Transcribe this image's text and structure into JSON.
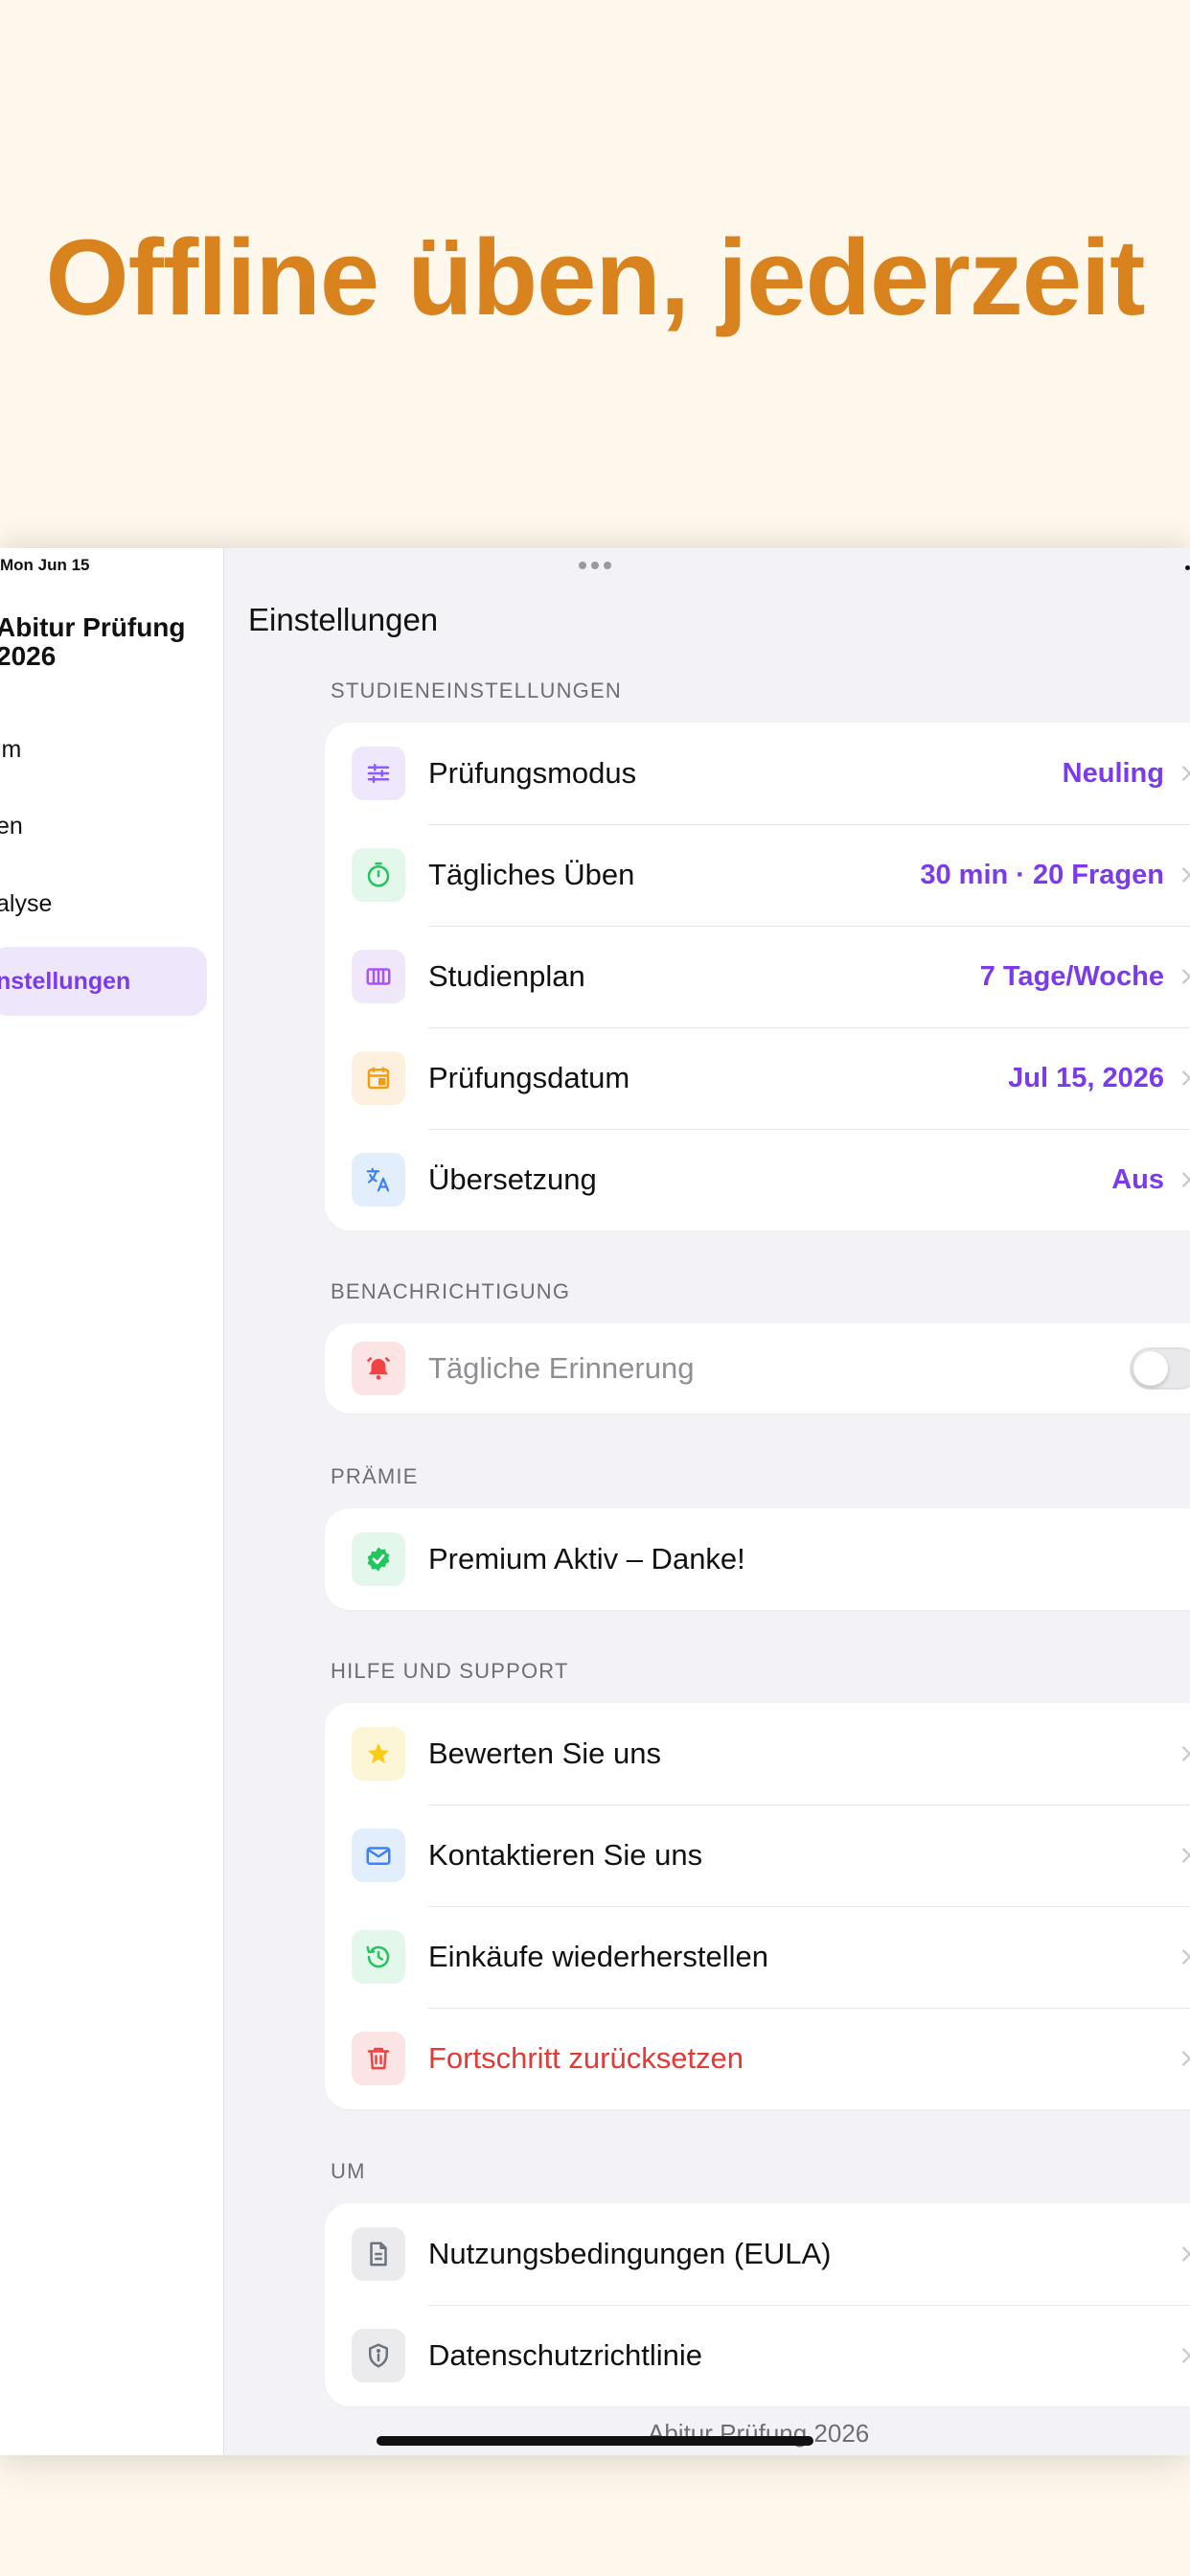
{
  "headline": "Offline üben, jederzeit",
  "status": {
    "date": "Mon Jun 15"
  },
  "sidebar": {
    "title": "Abitur Prüfung 2026",
    "items": [
      {
        "label": "im",
        "active": false
      },
      {
        "label": "en",
        "active": false
      },
      {
        "label": "alyse",
        "active": false
      },
      {
        "label": "nstellungen",
        "active": true
      }
    ]
  },
  "page": {
    "title": "Einstellungen"
  },
  "sections": {
    "study": {
      "label": "STUDIENEINSTELLUNGEN",
      "rows": [
        {
          "label": "Prüfungsmodus",
          "value": "Neuling",
          "icon": "sliders-icon"
        },
        {
          "label": "Tägliches Üben",
          "value": "30 min · 20 Fragen",
          "icon": "timer-icon"
        },
        {
          "label": "Studienplan",
          "value": "7 Tage/Woche",
          "icon": "calendar-grid-icon"
        },
        {
          "label": "Prüfungsdatum",
          "value": "Jul 15, 2026",
          "icon": "calendar-icon"
        },
        {
          "label": "Übersetzung",
          "value": "Aus",
          "icon": "translate-icon"
        }
      ]
    },
    "notification": {
      "label": "BENACHRICHTIGUNG",
      "rows": [
        {
          "label": "Tägliche Erinnerung",
          "toggle": false,
          "icon": "alarm-bell-icon"
        }
      ]
    },
    "premium": {
      "label": "PRÄMIE",
      "rows": [
        {
          "label": "Premium Aktiv – Danke!",
          "icon": "verified-badge-icon"
        }
      ]
    },
    "help": {
      "label": "HILFE UND SUPPORT",
      "rows": [
        {
          "label": "Bewerten Sie uns",
          "icon": "star-icon"
        },
        {
          "label": "Kontaktieren Sie uns",
          "icon": "mail-icon"
        },
        {
          "label": "Einkäufe wiederherstellen",
          "icon": "restore-icon"
        },
        {
          "label": "Fortschritt zurücksetzen",
          "icon": "trash-icon"
        }
      ]
    },
    "about": {
      "label": "UM",
      "rows": [
        {
          "label": "Nutzungsbedingungen (EULA)",
          "icon": "document-icon"
        },
        {
          "label": "Datenschutzrichtlinie",
          "icon": "shield-icon"
        }
      ]
    }
  },
  "footer": {
    "text": "Abitur Prüfung 2026"
  },
  "colors": {
    "accent": "#7C3AED",
    "headline": "#D9831F",
    "danger": "#E53935",
    "background": "#FEF8EC"
  }
}
